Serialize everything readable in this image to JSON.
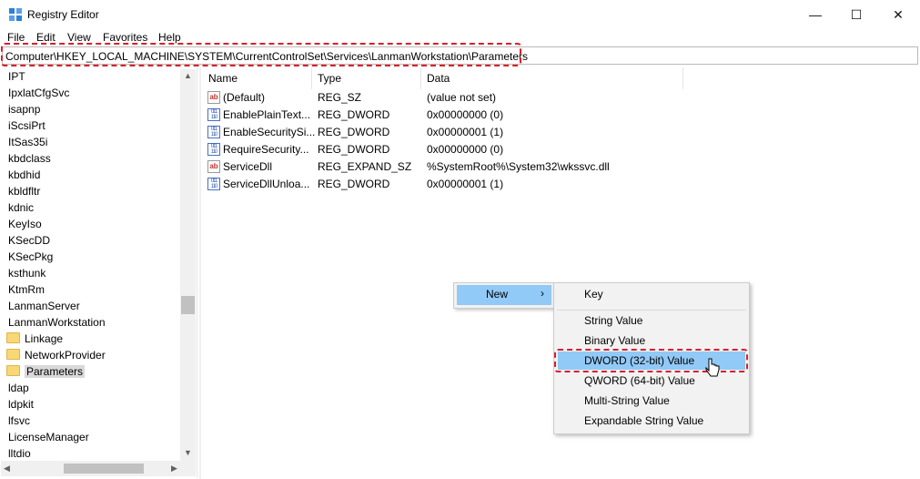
{
  "window": {
    "title": "Registry Editor",
    "controls": {
      "minimize": "—",
      "maximize": "☐",
      "close": "✕"
    }
  },
  "menubar": [
    "File",
    "Edit",
    "View",
    "Favorites",
    "Help"
  ],
  "address": {
    "path": "Computer\\HKEY_LOCAL_MACHINE\\SYSTEM\\CurrentControlSet\\Services\\LanmanWorkstation\\Parameters"
  },
  "tree": {
    "items": [
      {
        "label": "IPT",
        "folder": false
      },
      {
        "label": "IpxlatCfgSvc",
        "folder": false
      },
      {
        "label": "isapnp",
        "folder": false
      },
      {
        "label": "iScsiPrt",
        "folder": false
      },
      {
        "label": "ItSas35i",
        "folder": false
      },
      {
        "label": "kbdclass",
        "folder": false
      },
      {
        "label": "kbdhid",
        "folder": false
      },
      {
        "label": "kbldfltr",
        "folder": false
      },
      {
        "label": "kdnic",
        "folder": false
      },
      {
        "label": "KeyIso",
        "folder": false
      },
      {
        "label": "KSecDD",
        "folder": false
      },
      {
        "label": "KSecPkg",
        "folder": false
      },
      {
        "label": "ksthunk",
        "folder": false
      },
      {
        "label": "KtmRm",
        "folder": false
      },
      {
        "label": "LanmanServer",
        "folder": false
      },
      {
        "label": "LanmanWorkstation",
        "folder": false
      },
      {
        "label": "Linkage",
        "folder": true
      },
      {
        "label": "NetworkProvider",
        "folder": true
      },
      {
        "label": "Parameters",
        "folder": true,
        "selected": true
      },
      {
        "label": "ldap",
        "folder": false
      },
      {
        "label": "ldpkit",
        "folder": false
      },
      {
        "label": "lfsvc",
        "folder": false
      },
      {
        "label": "LicenseManager",
        "folder": false
      },
      {
        "label": "lltdio",
        "folder": false
      }
    ]
  },
  "list": {
    "columns": [
      "Name",
      "Type",
      "Data"
    ],
    "rows": [
      {
        "icon": "string-value-icon",
        "name": "(Default)",
        "type": "REG_SZ",
        "data": "(value not set)"
      },
      {
        "icon": "dword-value-icon",
        "name": "EnablePlainText...",
        "type": "REG_DWORD",
        "data": "0x00000000 (0)"
      },
      {
        "icon": "dword-value-icon",
        "name": "EnableSecuritySi...",
        "type": "REG_DWORD",
        "data": "0x00000001 (1)"
      },
      {
        "icon": "dword-value-icon",
        "name": "RequireSecurity...",
        "type": "REG_DWORD",
        "data": "0x00000000 (0)"
      },
      {
        "icon": "string-value-icon",
        "name": "ServiceDll",
        "type": "REG_EXPAND_SZ",
        "data": "%SystemRoot%\\System32\\wkssvc.dll"
      },
      {
        "icon": "dword-value-icon",
        "name": "ServiceDllUnloa...",
        "type": "REG_DWORD",
        "data": "0x00000001 (1)"
      }
    ]
  },
  "context_menu": {
    "new_label": "New",
    "new_arrow": "›",
    "submenu": [
      "Key",
      "String Value",
      "Binary Value",
      "DWORD (32-bit) Value",
      "QWORD (64-bit) Value",
      "Multi-String Value",
      "Expandable String Value"
    ],
    "highlighted": "DWORD (32-bit) Value"
  },
  "colors": {
    "highlight_dashed": "#d9202a",
    "menu_hover": "#91c9f7"
  }
}
